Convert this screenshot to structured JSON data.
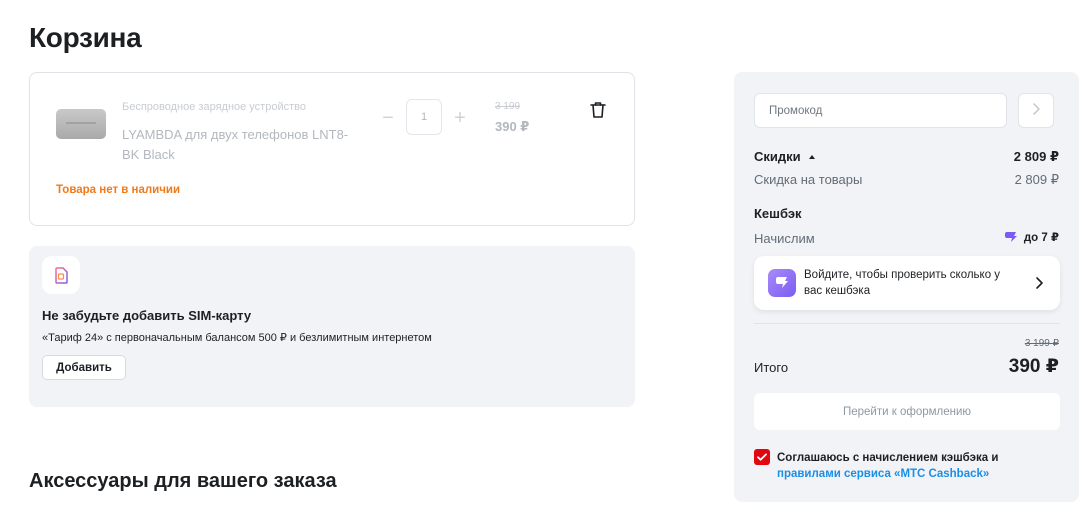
{
  "page": {
    "title": "Корзина"
  },
  "product": {
    "category": "Беспроводное зарядное устройство",
    "name": "LYAMBDA для двух телефонов LNT8-BK Black",
    "quantity": "1",
    "old_price": "3 199",
    "price": "390 ₽",
    "status": "Товара нет в наличии",
    "minus_symbol": "−",
    "plus_symbol": "+"
  },
  "sim_promo": {
    "title": "Не забудьте добавить SIM-карту",
    "description": "«Тариф 24» с первоначальным балансом 500 ₽ и безлимитным интернетом",
    "button_label": "Добавить"
  },
  "accessories": {
    "title": "Аксессуары для вашего заказа"
  },
  "summary": {
    "promo_placeholder": "Промокод",
    "discounts_label": "Скидки",
    "discounts_value": "2 809 ₽",
    "goods_discount_label": "Скидка на товары",
    "goods_discount_value": "2 809 ₽",
    "cashback_label": "Кешбэк",
    "accrue_label": "Начислим",
    "accrue_value": "до 7 ₽",
    "login_prompt": "Войдите, чтобы проверить сколько у вас кешбэка",
    "old_total": "3 199 ₽",
    "total_label": "Итого",
    "total_value": "390 ₽",
    "checkout_label": "Перейти к оформлению",
    "agree_text": "Соглашаюсь с начислением кэшбэка и",
    "agree_link": "правилами сервиса «МТС Cashback»"
  },
  "colors": {
    "accent_red": "#e30611",
    "warning_orange": "#f07a1a",
    "link_blue": "#1b8ee6",
    "cashback_purple": "#7c5cf0"
  },
  "icons": {
    "delete": "trash-icon",
    "promo_submit": "chevron-right-icon",
    "sim": "sim-card-icon",
    "cashback": "cashback-icon",
    "checkbox": "checkmark-icon"
  }
}
